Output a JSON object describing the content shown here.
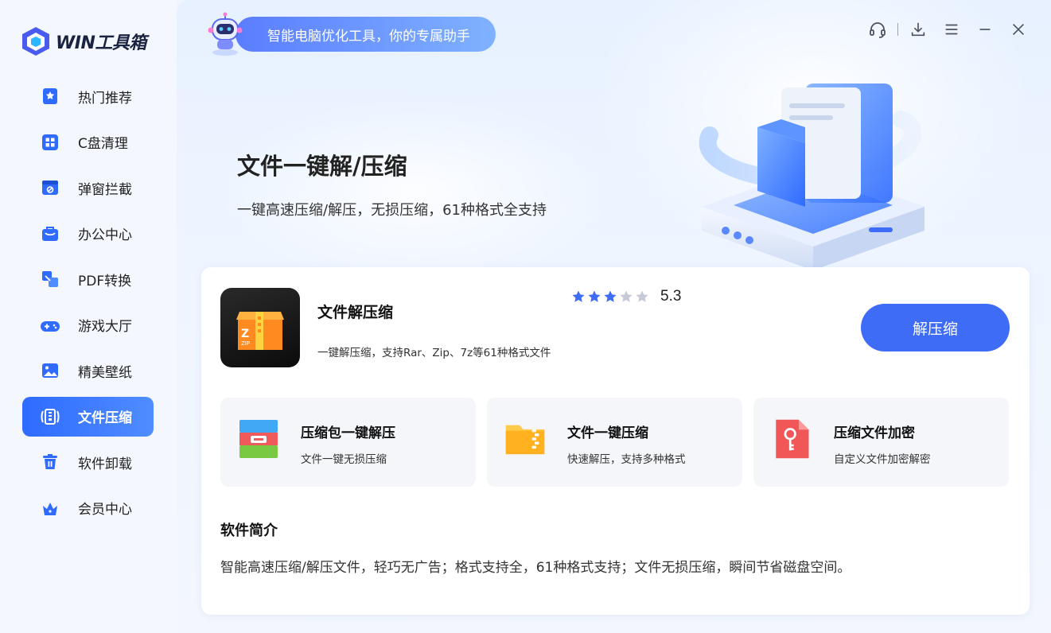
{
  "app": {
    "logo_text": "WIN工具箱"
  },
  "slogan": "智能电脑优化工具，你的专属助手",
  "window_controls": [
    "headset-icon",
    "download-icon",
    "menu-icon",
    "minimize-icon",
    "close-icon"
  ],
  "sidebar": {
    "items": [
      {
        "label": "热门推荐",
        "icon": "star-bookmark-icon",
        "active": false
      },
      {
        "label": "C盘清理",
        "icon": "grid-icon",
        "active": false
      },
      {
        "label": "弹窗拦截",
        "icon": "block-window-icon",
        "active": false
      },
      {
        "label": "办公中心",
        "icon": "briefcase-icon",
        "active": false
      },
      {
        "label": "PDF转换",
        "icon": "convert-icon",
        "active": false
      },
      {
        "label": "游戏大厅",
        "icon": "gamepad-icon",
        "active": false
      },
      {
        "label": "精美壁纸",
        "icon": "image-icon",
        "active": false
      },
      {
        "label": "文件压缩",
        "icon": "compress-icon",
        "active": true
      },
      {
        "label": "软件卸载",
        "icon": "trash-icon",
        "active": false
      },
      {
        "label": "会员中心",
        "icon": "crown-icon",
        "active": false
      }
    ]
  },
  "hero": {
    "title": "文件一键解/压缩",
    "subtitle": "一键高速压缩/解压，无损压缩，61种格式全支持"
  },
  "card": {
    "app_name": "文件解压缩",
    "app_desc": "一键解压缩，支持Rar、Zip、7z等61种格式文件",
    "rating": {
      "stars": 3,
      "max": 5,
      "score": "5.3"
    },
    "action_label": "解压缩",
    "features": [
      {
        "title": "压缩包一键解压",
        "desc": "文件一键无损压缩",
        "icon": "archive-icon"
      },
      {
        "title": "文件一键压缩",
        "desc": "快速解压，支持多种格式",
        "icon": "zip-folder-icon"
      },
      {
        "title": "压缩文件加密",
        "desc": "自定义文件加密解密",
        "icon": "key-file-icon"
      }
    ],
    "intro_title": "软件简介",
    "intro_text": "智能高速压缩/解压文件，轻巧无广告；格式支持全，61种格式支持；文件无损压缩，瞬间节省磁盘空间。"
  },
  "colors": {
    "accent": "#3e6cf6",
    "active_nav": "#2f6bff",
    "star_on": "#3e6cf6",
    "star_off": "#c5cad6"
  }
}
